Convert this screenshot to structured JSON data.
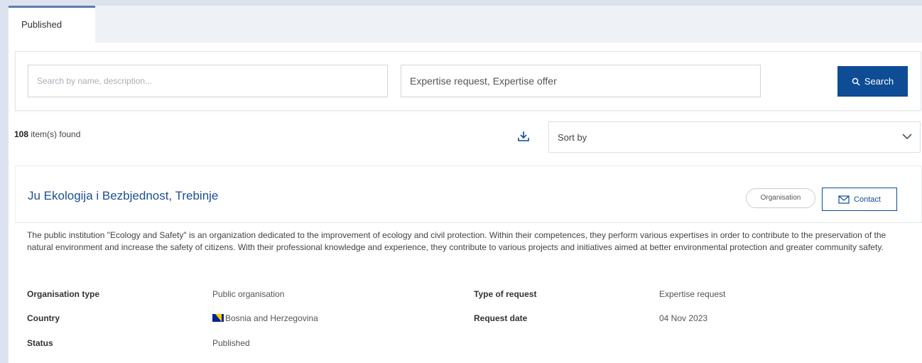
{
  "tabs": [
    {
      "label": "Published"
    }
  ],
  "search": {
    "name_placeholder": "Search by name, description...",
    "type_value": "Expertise request, Expertise offer",
    "button_label": "Search"
  },
  "results": {
    "count": "108",
    "count_suffix": "item(s) found"
  },
  "sort": {
    "label": "Sort by"
  },
  "result": {
    "title": "Ju Ekologija i Bezbjednost, Trebinje",
    "badge": "Organisation",
    "contact_label": "Contact",
    "description": "The public institution \"Ecology and Safety\" is an organization dedicated to the improvement of ecology and civil protection. Within their competences, they perform various expertises in order to contribute to the preservation of the natural environment and increase the safety of citizens. With their professional knowledge and experience, they contribute to various projects and initiatives aimed at better environmental protection and greater community safety.",
    "fields": {
      "org_type_label": "Organisation type",
      "org_type_value": "Public organisation",
      "request_type_label": "Type of request",
      "request_type_value": "Expertise request",
      "country_label": "Country",
      "country_value": "Bosnia and Herzegovina",
      "request_date_label": "Request date",
      "request_date_value": "04 Nov 2023",
      "status_label": "Status",
      "status_value": "Published"
    }
  },
  "colors": {
    "primary": "#0e4c96",
    "link": "#1d4f8f",
    "background": "#dce3ee"
  }
}
